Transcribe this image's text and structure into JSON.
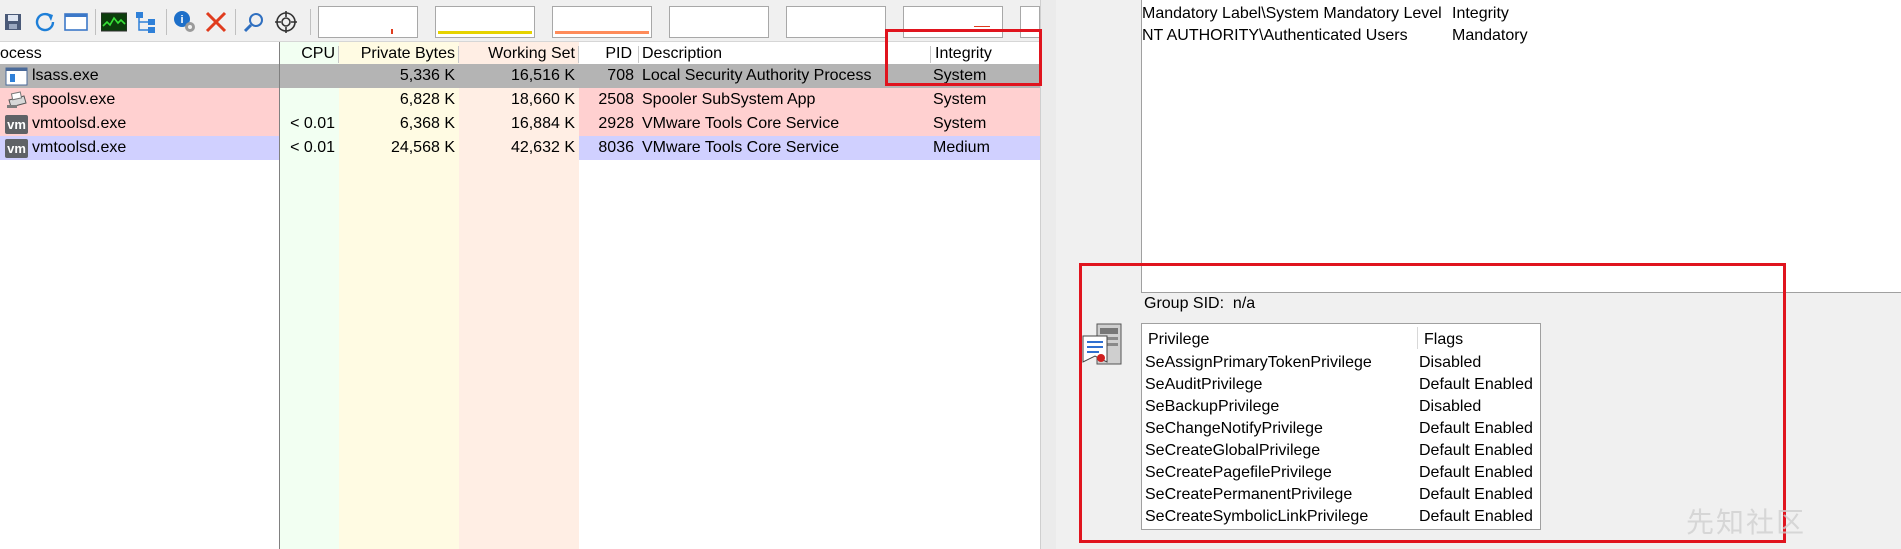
{
  "process_explorer": {
    "columns": {
      "process": "ocess",
      "cpu": "CPU",
      "private_bytes": "Private Bytes",
      "working_set": "Working Set",
      "pid": "PID",
      "description": "Description",
      "integrity": "Integrity"
    },
    "rows": [
      {
        "name": "lsass.exe",
        "cpu": "",
        "private_bytes": "5,336 K",
        "working_set": "16,516 K",
        "pid": "708",
        "description": "Local Security Authority Process",
        "integrity": "System",
        "icon": "lsass-window-icon"
      },
      {
        "name": "spoolsv.exe",
        "cpu": "",
        "private_bytes": "6,828 K",
        "working_set": "18,660 K",
        "pid": "2508",
        "description": "Spooler SubSystem App",
        "integrity": "System",
        "icon": "printer-icon"
      },
      {
        "name": "vmtoolsd.exe",
        "cpu": "< 0.01",
        "private_bytes": "6,368 K",
        "working_set": "16,884 K",
        "pid": "2928",
        "description": "VMware Tools Core Service",
        "integrity": "System",
        "icon": "vmware-icon"
      },
      {
        "name": "vmtoolsd.exe",
        "cpu": "< 0.01",
        "private_bytes": "24,568 K",
        "working_set": "42,632 K",
        "pid": "8036",
        "description": "VMware Tools Core Service",
        "integrity": "Medium",
        "icon": "vmware-icon"
      }
    ],
    "vm_icon_text": "vm",
    "colors": {
      "selected_row": "#b4b4b4",
      "service_row": "#ffd0d0",
      "own_process_row": "#d0d0ff",
      "private_bytes_col": "#fffbe3",
      "working_set_col": "#ffeee4",
      "cpu_col": "#f2fff2",
      "highlight": "#e0141e"
    },
    "toolbar_icons": [
      "save-icon",
      "refresh-icon",
      "window-icon",
      "cpu-graph-icon",
      "tree-icon",
      "properties-icon",
      "kill-process-icon",
      "find-icon",
      "target-icon"
    ]
  },
  "security": {
    "groups": [
      {
        "name": "Mandatory Label\\System Mandatory Level",
        "flags": "Integrity"
      },
      {
        "name": "NT AUTHORITY\\Authenticated Users",
        "flags": "Mandatory"
      }
    ],
    "group_sid_label": "Group SID:",
    "group_sid_value": "n/a",
    "privileges_header": {
      "privilege": "Privilege",
      "flags": "Flags"
    },
    "privileges": [
      {
        "name": "SeAssignPrimaryTokenPrivilege",
        "flags": "Disabled"
      },
      {
        "name": "SeAuditPrivilege",
        "flags": "Default Enabled"
      },
      {
        "name": "SeBackupPrivilege",
        "flags": "Disabled"
      },
      {
        "name": "SeChangeNotifyPrivilege",
        "flags": "Default Enabled"
      },
      {
        "name": "SeCreateGlobalPrivilege",
        "flags": "Default Enabled"
      },
      {
        "name": "SeCreatePagefilePrivilege",
        "flags": "Default Enabled"
      },
      {
        "name": "SeCreatePermanentPrivilege",
        "flags": "Default Enabled"
      },
      {
        "name": "SeCreateSymbolicLinkPrivilege",
        "flags": "Default Enabled"
      }
    ]
  },
  "watermark": "先知社区"
}
